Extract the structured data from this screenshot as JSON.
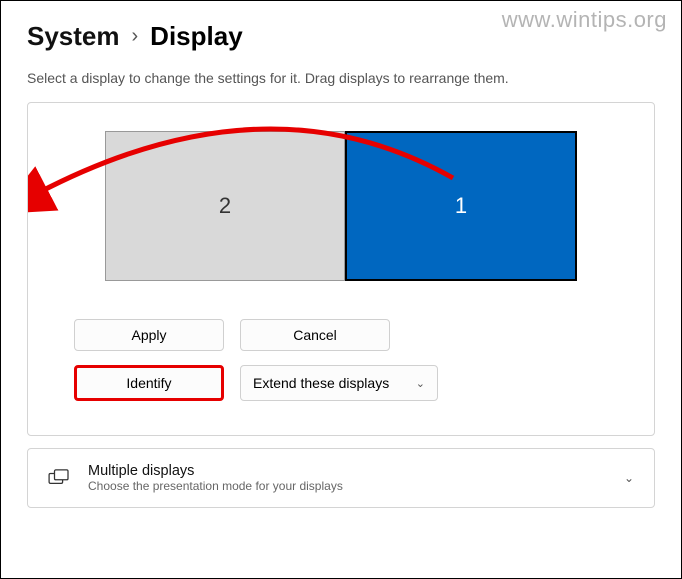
{
  "watermark": "www.wintips.org",
  "breadcrumb": {
    "parent": "System",
    "current": "Display"
  },
  "subtitle": "Select a display to change the settings for it. Drag displays to rearrange them.",
  "displays": {
    "left": "2",
    "right": "1"
  },
  "buttons": {
    "apply": "Apply",
    "cancel": "Cancel",
    "identify": "Identify"
  },
  "dropdown": {
    "selected": "Extend these displays"
  },
  "multiple": {
    "title": "Multiple displays",
    "subtitle": "Choose the presentation mode for your displays"
  }
}
